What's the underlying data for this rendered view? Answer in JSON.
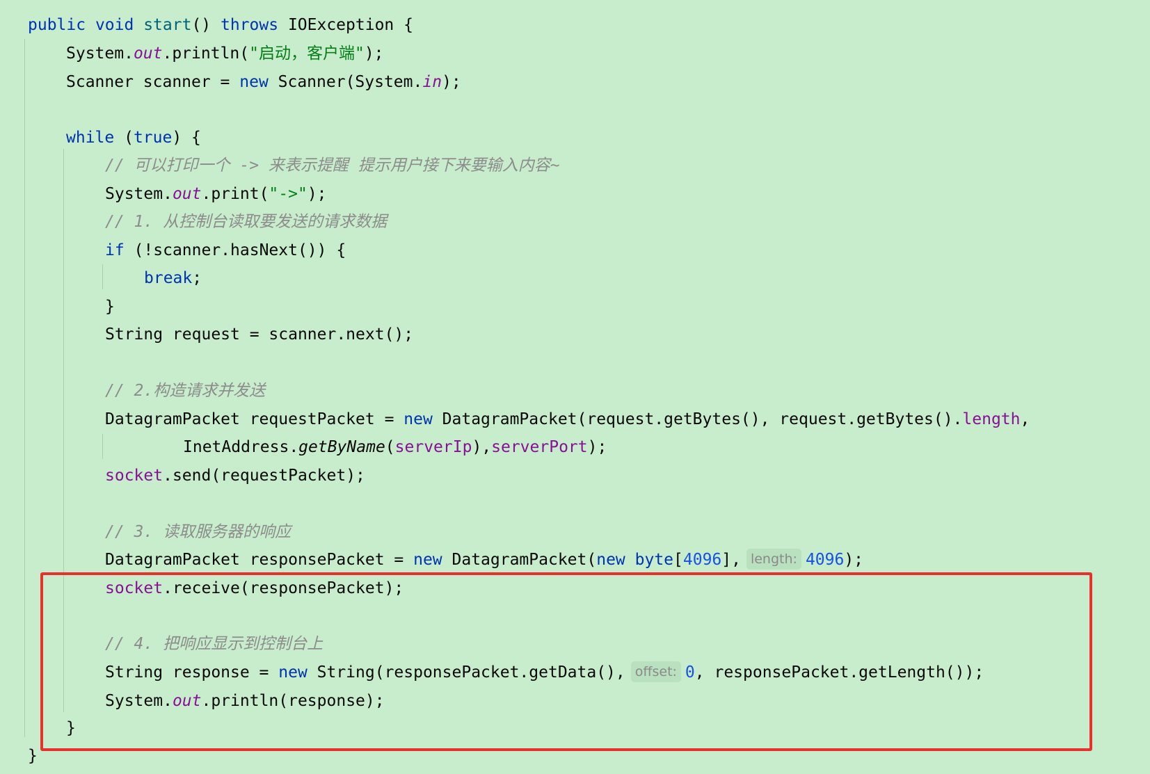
{
  "code": {
    "l1": {
      "kw1": "public",
      "kw2": "void",
      "name": "start",
      "p": "() ",
      "kw3": "throws",
      "rest": " IOException {"
    },
    "l2": {
      "a": "System.",
      "out": "out",
      "b": ".println(",
      "s": "\"启动，客户端\"",
      "c": ");"
    },
    "l3": {
      "a": "Scanner scanner = ",
      "kw": "new",
      "b": " Scanner(System.",
      "in": "in",
      "c": ");"
    },
    "l5": {
      "kw1": "while",
      "a": " (",
      "kw2": "true",
      "b": ") {"
    },
    "l6": {
      "cmt": "// 可以打印一个 -> 来表示提醒 提示用户接下来要输入内容~"
    },
    "l7": {
      "a": "System.",
      "out": "out",
      "b": ".print(",
      "s": "\"->\"",
      "c": ");"
    },
    "l8": {
      "cmt": "// 1. 从控制台读取要发送的请求数据"
    },
    "l9": {
      "kw": "if",
      "a": " (!scanner.hasNext()) {"
    },
    "l10": {
      "kw": "break",
      "a": ";"
    },
    "l11": {
      "a": "}"
    },
    "l12": {
      "a": "String request = scanner.next();"
    },
    "l14": {
      "cmt": "// 2.构造请求并发送"
    },
    "l15": {
      "a": "DatagramPacket requestPacket = ",
      "kw": "new",
      "b": " DatagramPacket(request.getBytes(), request.getBytes().",
      "f": "length",
      "c": ","
    },
    "l16": {
      "a": "InetAddress.",
      "m": "getByName",
      "b": "(",
      "f1": "serverIp",
      "c": "),",
      "f2": "serverPort",
      "d": ");"
    },
    "l17": {
      "f": "socket",
      "a": ".send(requestPacket);"
    },
    "l19": {
      "cmt": "// 3. 读取服务器的响应"
    },
    "l20": {
      "a": "DatagramPacket responsePacket = ",
      "kw1": "new",
      "b": " DatagramPacket(",
      "kw2": "new",
      "c": " ",
      "kw3": "byte",
      "d": "[",
      "n1": "4096",
      "e": "],",
      "hint": "length:",
      "n2": "4096",
      "f": ");"
    },
    "l21": {
      "f": "socket",
      "a": ".receive(responsePacket);"
    },
    "l23": {
      "cmt": "// 4. 把响应显示到控制台上"
    },
    "l24": {
      "a": "String response = ",
      "kw": "new",
      "b": " String(responsePacket.getData(),",
      "hint": "offset:",
      "n": "0",
      "c": ", responsePacket.getLength());"
    },
    "l25": {
      "a": "System.",
      "out": "out",
      "b": ".println(response);"
    },
    "l26": {
      "a": "}"
    },
    "l27": {
      "a": "}"
    }
  },
  "colors": {
    "background": "#c7edcc",
    "keyword": "#0033b3",
    "string": "#067d17",
    "field": "#871094",
    "number": "#1750eb",
    "comment": "#8c8c8c",
    "highlight_border": "#e8312d"
  }
}
